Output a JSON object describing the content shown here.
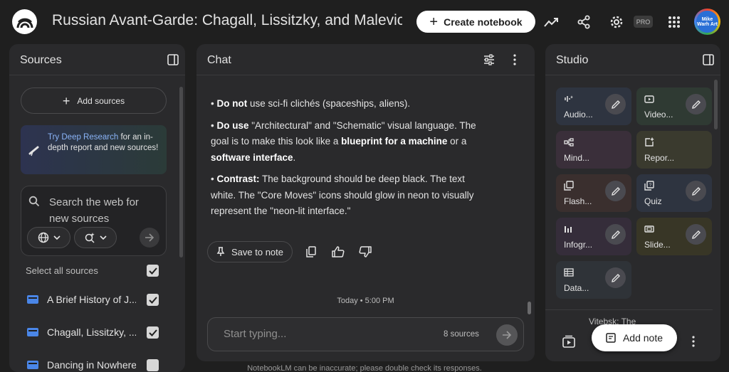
{
  "header": {
    "title": "Russian Avant-Garde: Chagall, Lissitzky, and Malevich",
    "create_label": "Create notebook",
    "pro_badge": "PRO",
    "avatar_text": "Mike Warh Art"
  },
  "sources": {
    "title": "Sources",
    "add_label": "Add sources",
    "deep_research": {
      "link": "Try Deep Research",
      "text": " for an in-depth report and new sources!"
    },
    "search_placeholder": "Search the web for new sources",
    "select_all": "Select all sources",
    "items": [
      {
        "label": "A Brief History of J..."
      },
      {
        "label": "Chagall, Lissitzky, ..."
      },
      {
        "label": "Dancing in Nowhere"
      }
    ]
  },
  "chat": {
    "title": "Chat",
    "paragraphs": [
      {
        "bold": "Do not",
        "text": " use sci-fi clichés (spaceships, aliens)."
      },
      {
        "bold": "Do use",
        "text": " \"Architectural\" and \"Schematic\" visual language. The goal is to make this look like a ",
        "bold2": "blueprint for a machine",
        "text2": " or a ",
        "bold3": "software interface",
        "text3": "."
      },
      {
        "bold": "Contrast:",
        "text": " The background should be deep black. The text white. The \"Core Moves\" icons should glow in neon to visually represent the \"neon-lit interface.\""
      }
    ],
    "save_label": "Save to note",
    "timestamp": "Today • 5:00 PM",
    "input_placeholder": "Start typing...",
    "source_count": "8 sources"
  },
  "studio": {
    "title": "Studio",
    "tiles": [
      {
        "label": "Audio...",
        "color": "#2e3440"
      },
      {
        "label": "Video...",
        "color": "#2f3a33"
      },
      {
        "label": "Mind...",
        "color": "#3a2f3a"
      },
      {
        "label": "Repor...",
        "color": "#3a3a2e"
      },
      {
        "label": "Flash...",
        "color": "#3a2f2e"
      },
      {
        "label": "Quiz",
        "color": "#2e3440"
      },
      {
        "label": "Infogr...",
        "color": "#352d3a"
      },
      {
        "label": "Slide...",
        "color": "#383626"
      },
      {
        "label": "Data...",
        "color": "#2f3338"
      }
    ],
    "note_title": "Vitebsk: The",
    "add_note_label": "Add note"
  },
  "footer": "NotebookLM can be inaccurate; please double check its responses."
}
